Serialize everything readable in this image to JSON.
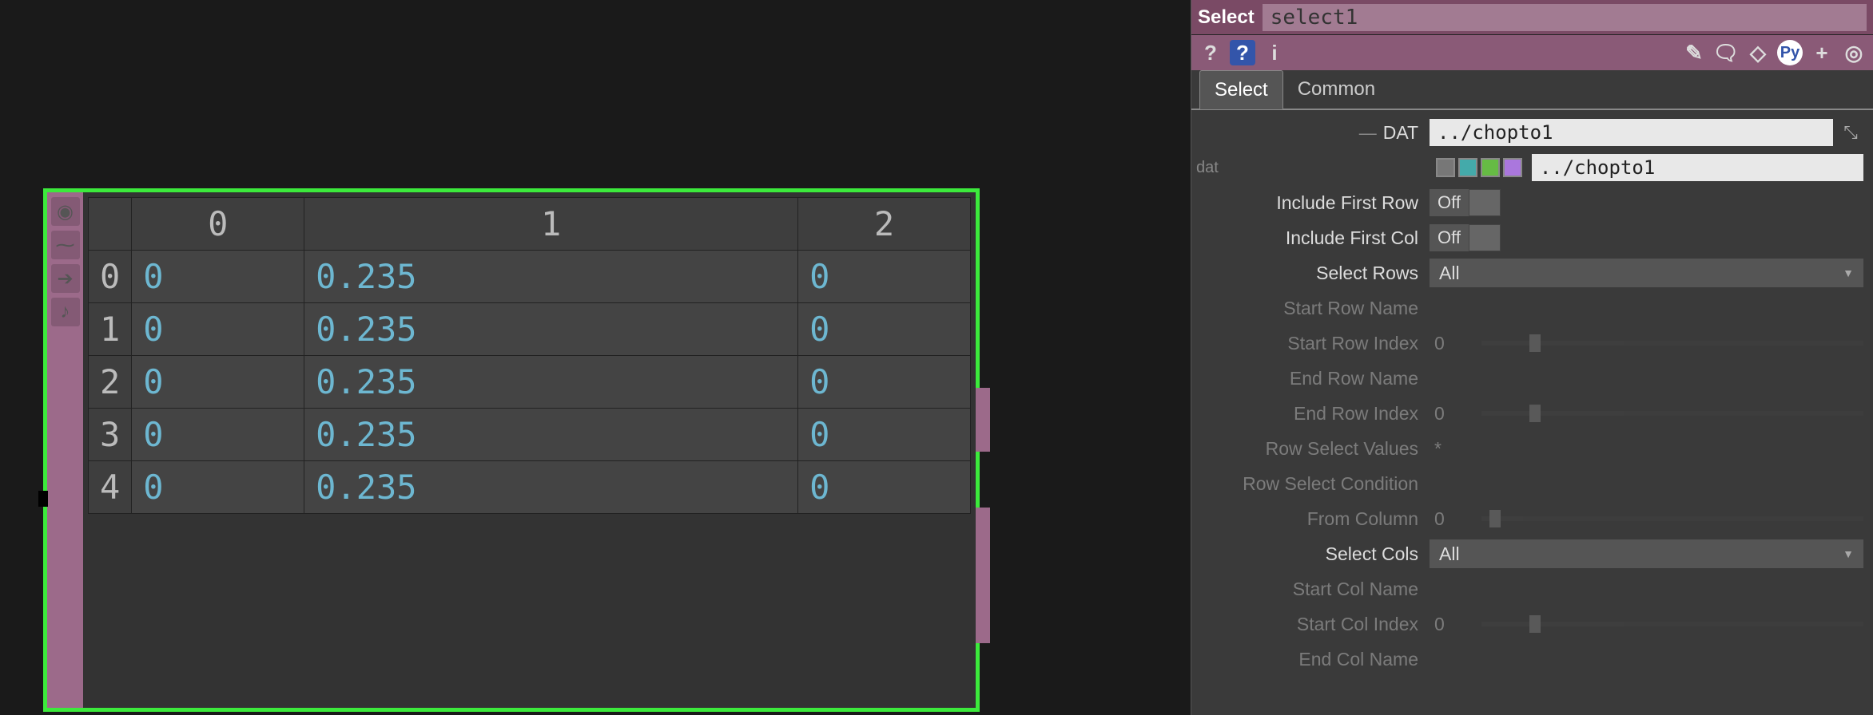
{
  "header": {
    "type_label": "Select",
    "name": "select1"
  },
  "tabs": [
    {
      "label": "Select",
      "active": true
    },
    {
      "label": "Common",
      "active": false
    }
  ],
  "params": {
    "dat": {
      "label": "DAT",
      "value": "../chopto1"
    },
    "dat_mini_label": "dat",
    "dat_mini_value": "../chopto1",
    "include_first_row": {
      "label": "Include First Row",
      "value": "Off"
    },
    "include_first_col": {
      "label": "Include First Col",
      "value": "Off"
    },
    "select_rows": {
      "label": "Select Rows",
      "value": "All"
    },
    "start_row_name": {
      "label": "Start Row Name",
      "value": ""
    },
    "start_row_index": {
      "label": "Start Row Index",
      "value": "0"
    },
    "end_row_name": {
      "label": "End Row  Name",
      "value": ""
    },
    "end_row_index": {
      "label": "End Row Index",
      "value": "0"
    },
    "row_select_values": {
      "label": "Row Select Values",
      "value": "*"
    },
    "row_select_condition": {
      "label": "Row Select Condition",
      "value": ""
    },
    "from_column": {
      "label": "From Column",
      "value": "0"
    },
    "select_cols": {
      "label": "Select Cols",
      "value": "All"
    },
    "start_col_name": {
      "label": "Start Col Name",
      "value": ""
    },
    "start_col_index": {
      "label": "Start Col Index",
      "value": "0"
    },
    "end_col_name": {
      "label": "End Col Name",
      "value": ""
    }
  },
  "table": {
    "col_headers": [
      "0",
      "1",
      "2"
    ],
    "rows": [
      {
        "idx": "0",
        "cells": [
          "0",
          "0.235",
          "0"
        ]
      },
      {
        "idx": "1",
        "cells": [
          "0",
          "0.235",
          "0"
        ]
      },
      {
        "idx": "2",
        "cells": [
          "0",
          "0.235",
          "0"
        ]
      },
      {
        "idx": "3",
        "cells": [
          "0",
          "0.235",
          "0"
        ]
      },
      {
        "idx": "4",
        "cells": [
          "0",
          "0.235",
          "0"
        ]
      }
    ]
  },
  "icons": {
    "help": "?",
    "help2": "?",
    "info": "i",
    "pencil": "✎",
    "comment": "🗨",
    "tag": "◇",
    "python": "Py",
    "plus": "+",
    "target": "◎"
  }
}
